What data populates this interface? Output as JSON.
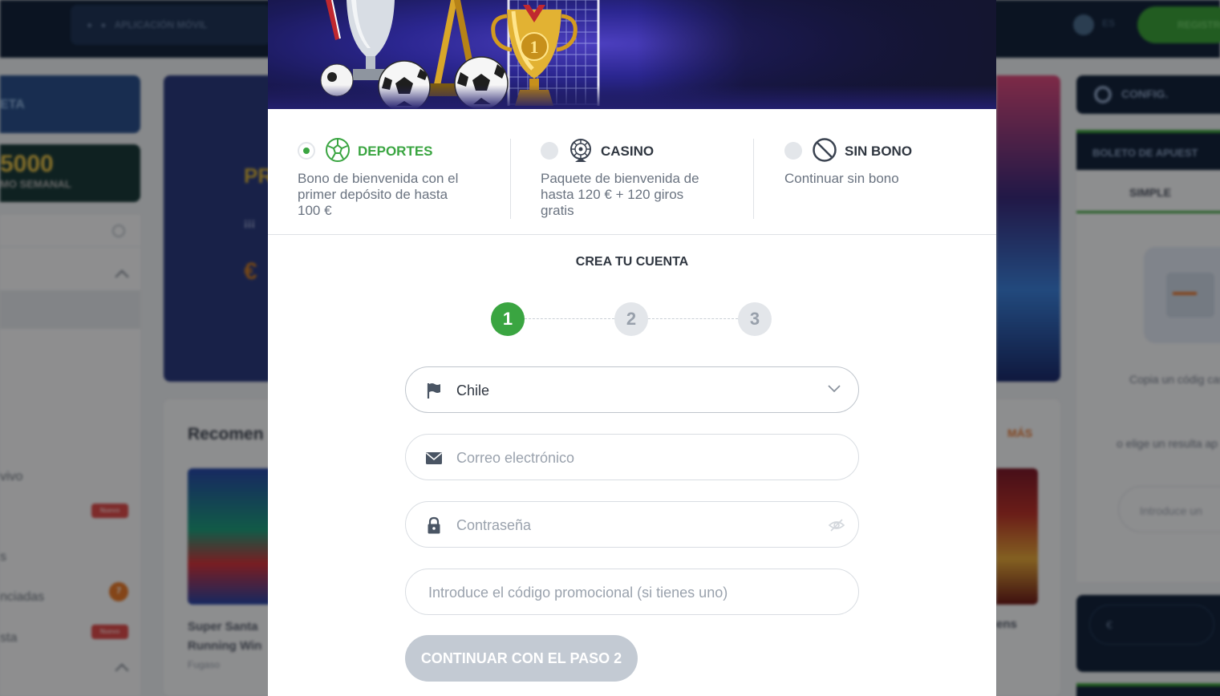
{
  "background": {
    "topbar": {
      "app_label": "APLICACIÓN MÓVIL",
      "lang": "ES",
      "register_label": "REGISTRO"
    },
    "left_sidebar": {
      "card1": "ETA",
      "card2_big": "5000",
      "card2_small": "MO SEMANAL",
      "rows": [
        {
          "label": "vivo",
          "badge": ""
        },
        {
          "label": "",
          "badge": "Nuevo"
        },
        {
          "label": "s",
          "badge": ""
        },
        {
          "label": "nciadas",
          "badge": "7"
        },
        {
          "label": "sta",
          "badge": "Nuevo"
        }
      ]
    },
    "main": {
      "banner_line1": "PR",
      "banner_line2": "¡¡¡",
      "banner_line3": "€",
      "recommended_title": "Recomen",
      "game_name": "Super Santa Running Win",
      "game_provider": "Fugaso",
      "more_label": "MÁS",
      "game2_name": "ens"
    },
    "right_sidebar": {
      "config_label": "CONFIG.",
      "betslip_label": "BOLETO DE APUEST",
      "simple_tab": "SIMPLE",
      "help_text_1": "Copia un códig casilla",
      "help_text_2": "o elige un resulta ap",
      "code_placeholder": "Introduce un",
      "currency_placeholder": "€"
    }
  },
  "modal": {
    "bonus_options": [
      {
        "title": "DEPORTES",
        "description": "Bono de bienvenida con el primer depósito de hasta 100 €",
        "selected": true,
        "icon": "soccer-ball-icon"
      },
      {
        "title": "CASINO",
        "description": "Paquete de bienvenida de hasta 120 € + 120 giros gratis",
        "selected": false,
        "icon": "roulette-icon"
      },
      {
        "title": "SIN BONO",
        "description": "Continuar sin bono",
        "selected": false,
        "icon": "no-entry-icon"
      }
    ],
    "form_title": "CREA TU CUENTA",
    "steps": [
      "1",
      "2",
      "3"
    ],
    "active_step": 1,
    "country": {
      "value": "Chile",
      "icon": "flag-icon"
    },
    "email": {
      "placeholder": "Correo electrónico",
      "icon": "envelope-icon"
    },
    "password": {
      "placeholder": "Contraseña",
      "icon": "lock-icon"
    },
    "promo": {
      "placeholder": "Introduce el código promocional (si tienes uno)"
    },
    "submit_label": "CONTINUAR CON EL PASO 2",
    "colors": {
      "accent": "#3aa541",
      "submit_disabled": "#c3cad3",
      "text_dark": "#2f3640",
      "text_muted": "#6a7380"
    }
  }
}
